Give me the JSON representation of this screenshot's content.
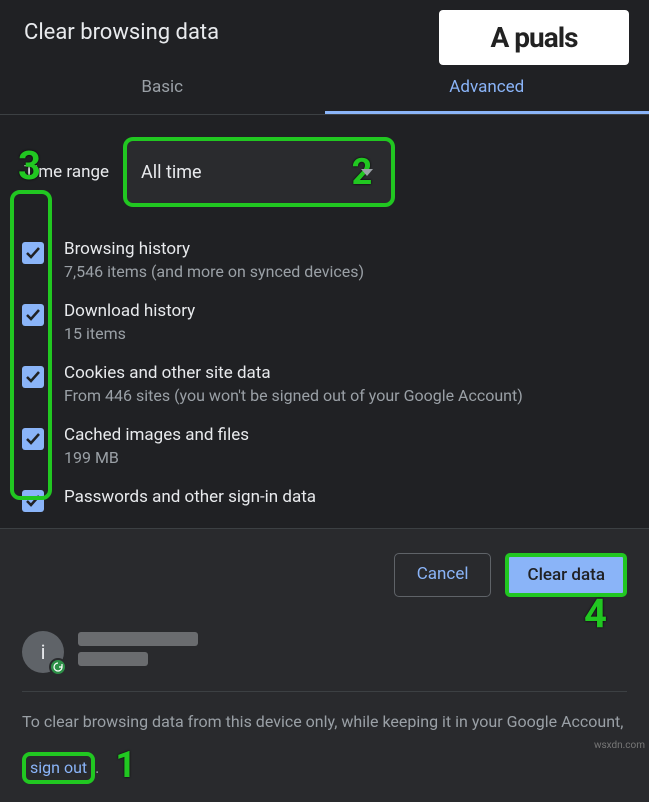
{
  "watermark": {
    "brand": "A puals",
    "site": "wsxdn.com"
  },
  "dialog": {
    "title": "Clear browsing data"
  },
  "tabs": {
    "basic": "Basic",
    "advanced": "Advanced"
  },
  "timeRange": {
    "label": "Time range",
    "value": "All time"
  },
  "annotations": {
    "n1": "1",
    "n2": "2",
    "n3": "3",
    "n4": "4"
  },
  "options": [
    {
      "title": "Browsing history",
      "sub": "7,546 items (and more on synced devices)"
    },
    {
      "title": "Download history",
      "sub": "15 items"
    },
    {
      "title": "Cookies and other site data",
      "sub": "From 446 sites (you won't be signed out of your Google Account)"
    },
    {
      "title": "Cached images and files",
      "sub": "199 MB"
    },
    {
      "title": "Passwords and other sign-in data",
      "sub": ""
    }
  ],
  "buttons": {
    "cancel": "Cancel",
    "clear": "Clear data"
  },
  "avatar": {
    "initial": "i"
  },
  "footer": {
    "pre": "To clear browsing data from this device only, while keeping it in your Google Account, ",
    "link": "sign out",
    "post": "."
  }
}
